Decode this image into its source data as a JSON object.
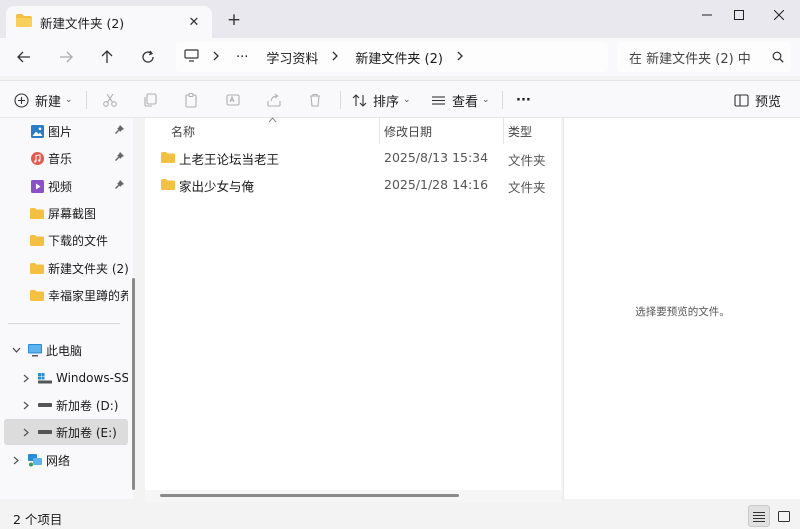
{
  "tab": {
    "title": "新建文件夹 (2)",
    "close": "✕",
    "new_tab": "+"
  },
  "window": {
    "minimize": "—",
    "maximize": "☐",
    "close": "✕"
  },
  "nav": {
    "breadcrumb_more": "···",
    "breadcrumbs": [
      "学习资料",
      "新建文件夹 (2)"
    ],
    "search_placeholder": "在 新建文件夹 (2) 中"
  },
  "commands": {
    "new_label": "新建",
    "sort_label": "排序",
    "view_label": "查看",
    "more_label": "···",
    "preview_label": "预览"
  },
  "sidebar": {
    "quick": [
      {
        "label": "图片",
        "icon": "pictures-icon",
        "pinned": true
      },
      {
        "label": "音乐",
        "icon": "music-icon",
        "pinned": true
      },
      {
        "label": "视频",
        "icon": "videos-icon",
        "pinned": true
      },
      {
        "label": "屏幕截图",
        "icon": "folder-icon",
        "pinned": false
      },
      {
        "label": "下载的文件",
        "icon": "folder-icon",
        "pinned": false
      },
      {
        "label": "新建文件夹 (2)",
        "icon": "folder-icon",
        "pinned": false
      },
      {
        "label": "幸福家里蹲的养",
        "icon": "folder-icon",
        "pinned": false
      }
    ],
    "this_pc": "此电脑",
    "drives": [
      {
        "label": "Windows-SSD",
        "icon": "windows-drive-icon"
      },
      {
        "label": "新加卷 (D:)",
        "icon": "drive-icon"
      },
      {
        "label": "新加卷 (E:)",
        "icon": "drive-icon",
        "selected": true
      }
    ],
    "network": "网络"
  },
  "columns": {
    "name": "名称",
    "date": "修改日期",
    "type": "类型"
  },
  "files": [
    {
      "name": "上老王论坛当老王",
      "date": "2025/8/13 15:34",
      "type": "文件夹"
    },
    {
      "name": "家出少女与俺",
      "date": "2025/1/28 14:16",
      "type": "文件夹"
    }
  ],
  "preview": {
    "message": "选择要预览的文件。"
  },
  "status": {
    "count": "2 个项目"
  },
  "colors": {
    "folder": "#F4C042",
    "accent": "#0067C0"
  }
}
